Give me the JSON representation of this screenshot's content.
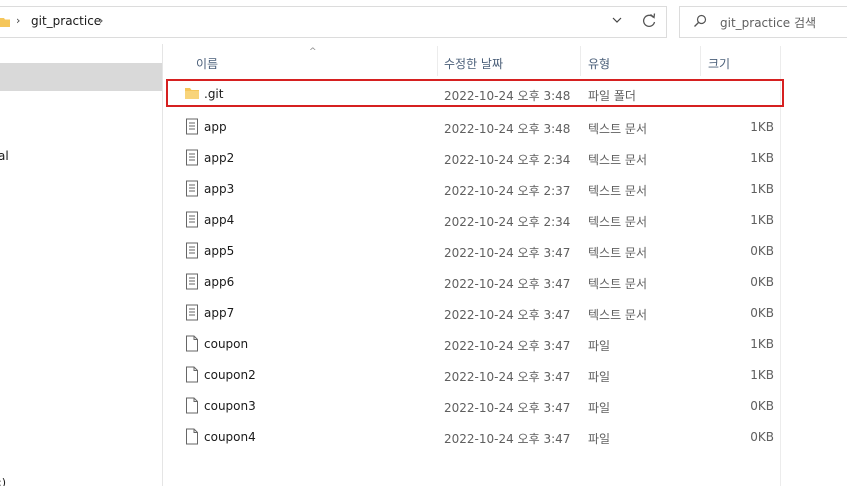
{
  "address": {
    "current_folder": "git_practice",
    "sep": "›"
  },
  "search": {
    "placeholder": "git_practice 검색"
  },
  "nav": {
    "partial_item": "al",
    "partial_item_bottom": ":)"
  },
  "columns": {
    "name": "이름",
    "date": "수정한 날짜",
    "type": "유형",
    "size": "크기"
  },
  "files": [
    {
      "name": ".git",
      "date": "2022-10-24 오후 3:48",
      "type": "파일 폴더",
      "size": "",
      "icon": "folder-icon"
    },
    {
      "name": "app",
      "date": "2022-10-24 오후 3:48",
      "type": "텍스트 문서",
      "size": "1KB",
      "icon": "text-document-icon"
    },
    {
      "name": "app2",
      "date": "2022-10-24 오후 2:34",
      "type": "텍스트 문서",
      "size": "1KB",
      "icon": "text-document-icon"
    },
    {
      "name": "app3",
      "date": "2022-10-24 오후 2:37",
      "type": "텍스트 문서",
      "size": "1KB",
      "icon": "text-document-icon"
    },
    {
      "name": "app4",
      "date": "2022-10-24 오후 2:34",
      "type": "텍스트 문서",
      "size": "1KB",
      "icon": "text-document-icon"
    },
    {
      "name": "app5",
      "date": "2022-10-24 오후 3:47",
      "type": "텍스트 문서",
      "size": "0KB",
      "icon": "text-document-icon"
    },
    {
      "name": "app6",
      "date": "2022-10-24 오후 3:47",
      "type": "텍스트 문서",
      "size": "0KB",
      "icon": "text-document-icon"
    },
    {
      "name": "app7",
      "date": "2022-10-24 오후 3:47",
      "type": "텍스트 문서",
      "size": "0KB",
      "icon": "text-document-icon"
    },
    {
      "name": "coupon",
      "date": "2022-10-24 오후 3:47",
      "type": "파일",
      "size": "1KB",
      "icon": "blank-file-icon"
    },
    {
      "name": "coupon2",
      "date": "2022-10-24 오후 3:47",
      "type": "파일",
      "size": "1KB",
      "icon": "blank-file-icon"
    },
    {
      "name": "coupon3",
      "date": "2022-10-24 오후 3:47",
      "type": "파일",
      "size": "0KB",
      "icon": "blank-file-icon"
    },
    {
      "name": "coupon4",
      "date": "2022-10-24 오후 3:47",
      "type": "파일",
      "size": "0KB",
      "icon": "blank-file-icon"
    }
  ],
  "colors": {
    "highlight_outline": "#d62020",
    "folder_yellow": "#f5c65a",
    "header_text": "#4c607a",
    "nav_selected": "#d9d9d9"
  }
}
